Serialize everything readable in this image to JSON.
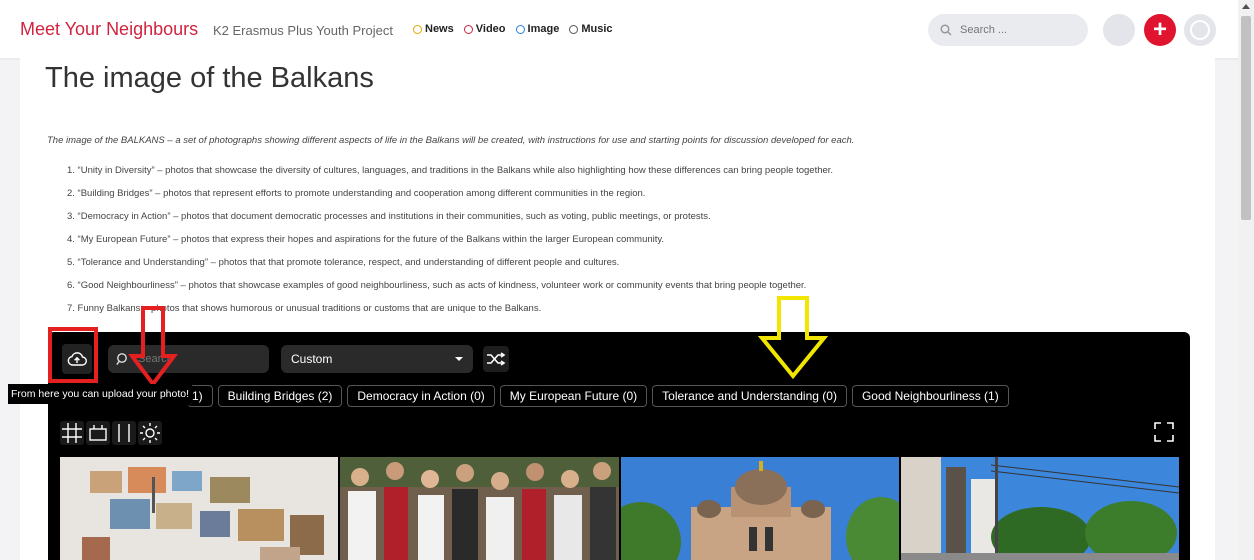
{
  "header": {
    "site_title": "Meet Your Neighbours",
    "subtitle": "K2 Erasmus Plus Youth Project",
    "nav": [
      {
        "label": "News",
        "color": "#e2a900"
      },
      {
        "label": "Video",
        "color": "#d0243e"
      },
      {
        "label": "Image",
        "color": "#2a7de1"
      },
      {
        "label": "Music",
        "color": "#555555"
      }
    ],
    "search_placeholder": "Search ...",
    "add_label": "+"
  },
  "page": {
    "title": "The image of the Balkans",
    "intro": "The image of the BALKANS – a set of photographs showing different aspects of life in the Balkans will be created, with instructions for use and starting points for discussion developed for each.",
    "topics": [
      "1. “Unity in Diversity” – photos that showcase the diversity of cultures, languages, and traditions in the Balkans while also highlighting how these differences can bring people together.",
      "2. “Building Bridges” – photos that represent efforts to promote understanding and cooperation among different communities in the region.",
      "3. “Democracy in Action” – photos that document democratic processes and institutions in their communities, such as voting, public meetings, or protests.",
      "4. “My European Future” – photos that express their hopes and aspirations for the future of the Balkans within the larger European community.",
      "5. “Tolerance and Understanding” – photos that that promote tolerance, respect, and understanding of different people and cultures.",
      "6. “Good Neighbourliness” – photos that showcase examples of good neighbourliness, such as acts of kindness, volunteer work or community events that bring people together.",
      "7. Funny Balkans – photos that shows humorous or unusual traditions or customs that are unique to the Balkans."
    ]
  },
  "gallery": {
    "search_placeholder": "Search",
    "sort_value": "Custom",
    "upload_tooltip": "From here you can upload your photo!",
    "chips": [
      {
        "label": "1)"
      },
      {
        "label": "Building Bridges (2)"
      },
      {
        "label": "Democracy in Action (0)"
      },
      {
        "label": "My European Future (0)"
      },
      {
        "label": "Tolerance and Understanding (0)"
      },
      {
        "label": "Good Neighbourliness (1)"
      }
    ],
    "icons": {
      "upload": "cloud-upload-icon",
      "search": "search-icon",
      "shuffle": "shuffle-icon",
      "grid": "grid-view-icon",
      "slider": "slider-view-icon",
      "column": "column-view-icon",
      "brightness": "brightness-icon",
      "fullscreen": "fullscreen-icon"
    },
    "photos": [
      "photo-wall-collage",
      "folk-dance-crowd",
      "orthodox-church",
      "city-street-trolley"
    ]
  },
  "colors": {
    "brand_red": "#d0243e",
    "add_button": "#e0142e",
    "annotation_red": "#e52020",
    "annotation_yellow": "#f2e600",
    "gallery_bg": "#000000"
  }
}
